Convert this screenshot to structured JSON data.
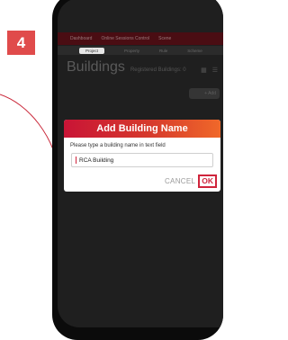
{
  "step_number": "4",
  "app": {
    "topbar_items": [
      "Dashboard",
      "Online Sessions Control",
      "Scene"
    ],
    "tabs": [
      "Project",
      "Property",
      "Rule",
      "Scheme"
    ],
    "active_tab_index": 0,
    "page_title": "Buildings",
    "page_subtitle": "Registered Buildings: 0",
    "add_chip_label": "+ Add"
  },
  "dialog": {
    "title": "Add Building Name",
    "instruction": "Please type a building name in text field",
    "input_value": "RCA Building",
    "cancel_label": "CANCEL",
    "ok_label": "OK"
  },
  "colors": {
    "accent": "#d0243c",
    "badge": "#e04b4b",
    "gradient_start": "#c91436",
    "gradient_end": "#f0682a"
  }
}
